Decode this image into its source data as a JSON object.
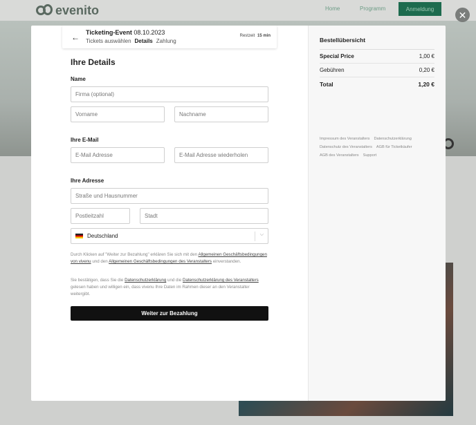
{
  "background": {
    "logo_text": "evenito",
    "nav": [
      "Home",
      "Programm"
    ],
    "register_button": "Anmeldung"
  },
  "close_label": "✕",
  "header": {
    "back_icon": "arrow-left-icon",
    "event_name": "Ticketing-Event",
    "event_date": "08.10.2023",
    "steps": [
      "Tickets auswählen",
      "Details",
      "Zahlung"
    ],
    "active_step": "Details",
    "timer_label": "Restzeit",
    "timer_value": "15 min"
  },
  "form": {
    "title": "Ihre Details",
    "name_label": "Name",
    "company_placeholder": "Firma (optional)",
    "firstname_placeholder": "Vorname",
    "lastname_placeholder": "Nachname",
    "email_label": "Ihre E-Mail",
    "email_placeholder": "E-Mail Adresse",
    "email_repeat_placeholder": "E-Mail Adresse wiederholen",
    "address_label": "Ihre Adresse",
    "street_placeholder": "Straße und Hausnummer",
    "zip_placeholder": "Postleitzahl",
    "city_placeholder": "Stadt",
    "country_value": "Deutschland",
    "legal1_a": "Durch Klicken auf \"Weiter zur Bezahlung\" erklären Sie sich mit den ",
    "legal1_link1": "Allgemeinen Geschäftsbedingungen von vivenu",
    "legal1_b": " und den ",
    "legal1_link2": "Allgemeinen Geschäftsbedingungen des Veranstalters",
    "legal1_c": " einverstanden.",
    "legal2_a": "Sie bestätigen, dass Sie die ",
    "legal2_link1": "Datenschutzerklärung",
    "legal2_b": " und die ",
    "legal2_link2": "Datenschutzerklärung des Veranstalters",
    "legal2_c": " gelesen haben und willigen ein, dass vivenu Ihre Daten im Rahmen dieser an den Veranstalter weitergibt.",
    "submit_label": "Weiter zur Bezahlung"
  },
  "summary": {
    "title": "Bestellübersicht",
    "rows": [
      {
        "label": "Special Price",
        "value": "1,00 €"
      },
      {
        "label": "Gebühren",
        "value": "0,20 €"
      },
      {
        "label": "Total",
        "value": "1,20 €"
      }
    ],
    "links": [
      "Impressum des Veranstalters",
      "Datenschutzerklärung",
      "Datenschutz des Veranstalters",
      "AGB für Ticketkäufer",
      "AGB des Veranstalters",
      "Support"
    ]
  }
}
